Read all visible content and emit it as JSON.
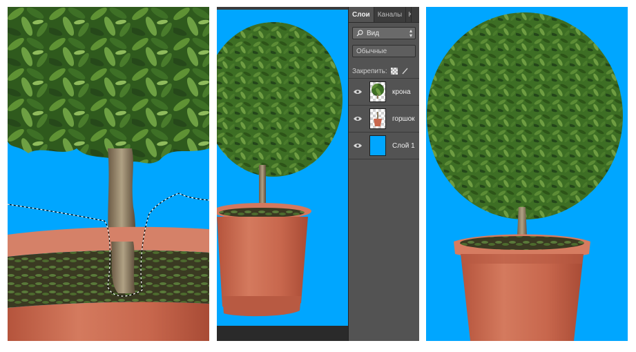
{
  "layers_panel": {
    "tabs": [
      {
        "label": "Слои",
        "active": true
      },
      {
        "label": "Каналы",
        "active": false
      },
      {
        "label": "К",
        "active": false
      }
    ],
    "filter": {
      "value": "Вид",
      "icon": "search-icon"
    },
    "blend_mode": {
      "value": "Обычные"
    },
    "lock_label": "Закрепить:",
    "layers": [
      {
        "name": "крона",
        "visible": true,
        "thumb": "tree-crown"
      },
      {
        "name": "горшок",
        "visible": true,
        "thumb": "pot"
      },
      {
        "name": "Слой 1",
        "visible": true,
        "thumb": "blue-fill"
      }
    ]
  },
  "colors": {
    "background_blue": "#00a6ff",
    "pot": "#c8674d",
    "foliage": "#3a6a22",
    "panel_dark": "#535353"
  }
}
